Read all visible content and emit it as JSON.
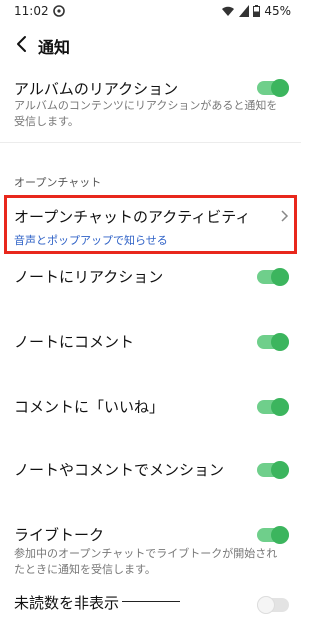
{
  "status_bar": {
    "time": "11:02",
    "battery": "45%"
  },
  "header": {
    "title": "通知"
  },
  "rows": [
    {
      "label": "アルバムのリアクション",
      "desc": "アルバムのコンテンツにリアクションがあると通知を受信します。",
      "toggle": true
    },
    {
      "label": "オープンチャットのアクティビティ",
      "sub": "音声とポップアップで知らせる"
    },
    {
      "label": "ノートにリアクション",
      "toggle": true
    },
    {
      "label": "ノートにコメント",
      "toggle": true
    },
    {
      "label": "コメントに「いいね」",
      "toggle": true
    },
    {
      "label": "ノートやコメントでメンション",
      "toggle": true
    },
    {
      "label": "ライブトーク",
      "desc": "参加中のオープンチャットでライブトークが開始されたときに通知を受信します。",
      "toggle": true
    },
    {
      "label": "未読数を非表示",
      "toggle": false
    }
  ],
  "section_label": "オープンチャット",
  "colors": {
    "accent_green": "#3cb55e",
    "highlight_red": "#e8271c",
    "link_blue": "#2f62c7"
  },
  "icons": [
    "app-status-icon",
    "wifi-icon",
    "signal-icon",
    "battery-icon",
    "back-arrow-icon",
    "chevron-right-icon"
  ]
}
